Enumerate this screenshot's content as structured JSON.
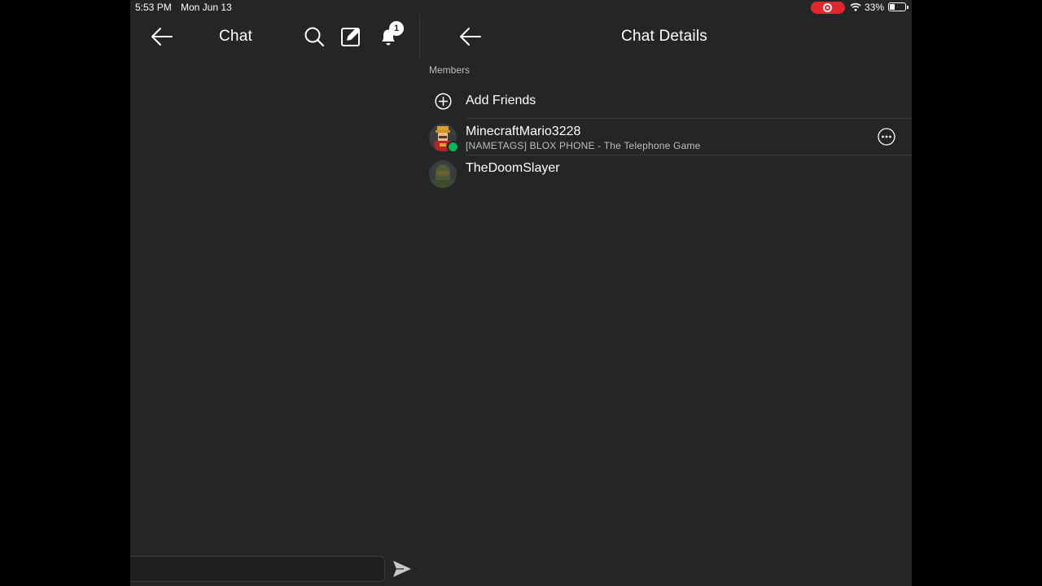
{
  "status_bar": {
    "time": "5:53 PM",
    "date": "Mon Jun 13",
    "battery_percent": "33%",
    "battery_level": 0.33,
    "recording_indicator": "screen-record-icon",
    "wifi_icon": "wifi-icon"
  },
  "chat_pane": {
    "title": "Chat",
    "icons": [
      "back-arrow-icon",
      "search-icon",
      "compose-icon",
      "bell-icon",
      "send-icon"
    ],
    "notification_count": "1",
    "message_input": {
      "value": "",
      "placeholder": ""
    }
  },
  "details_pane": {
    "title": "Chat Details",
    "members_label": "Members",
    "add_friends_label": "Add Friends",
    "members": [
      {
        "name": "MinecraftMario3228",
        "status": "[NAMETAGS] BLOX PHONE - The Telephone Game",
        "online": true
      },
      {
        "name": "TheDoomSlayer",
        "status": "",
        "online": false
      }
    ]
  },
  "colors": {
    "background": "#232527",
    "divider": "#393b3d",
    "online": "#02b757",
    "record": "#e0282e",
    "secondary_text": "#bdbebe"
  }
}
